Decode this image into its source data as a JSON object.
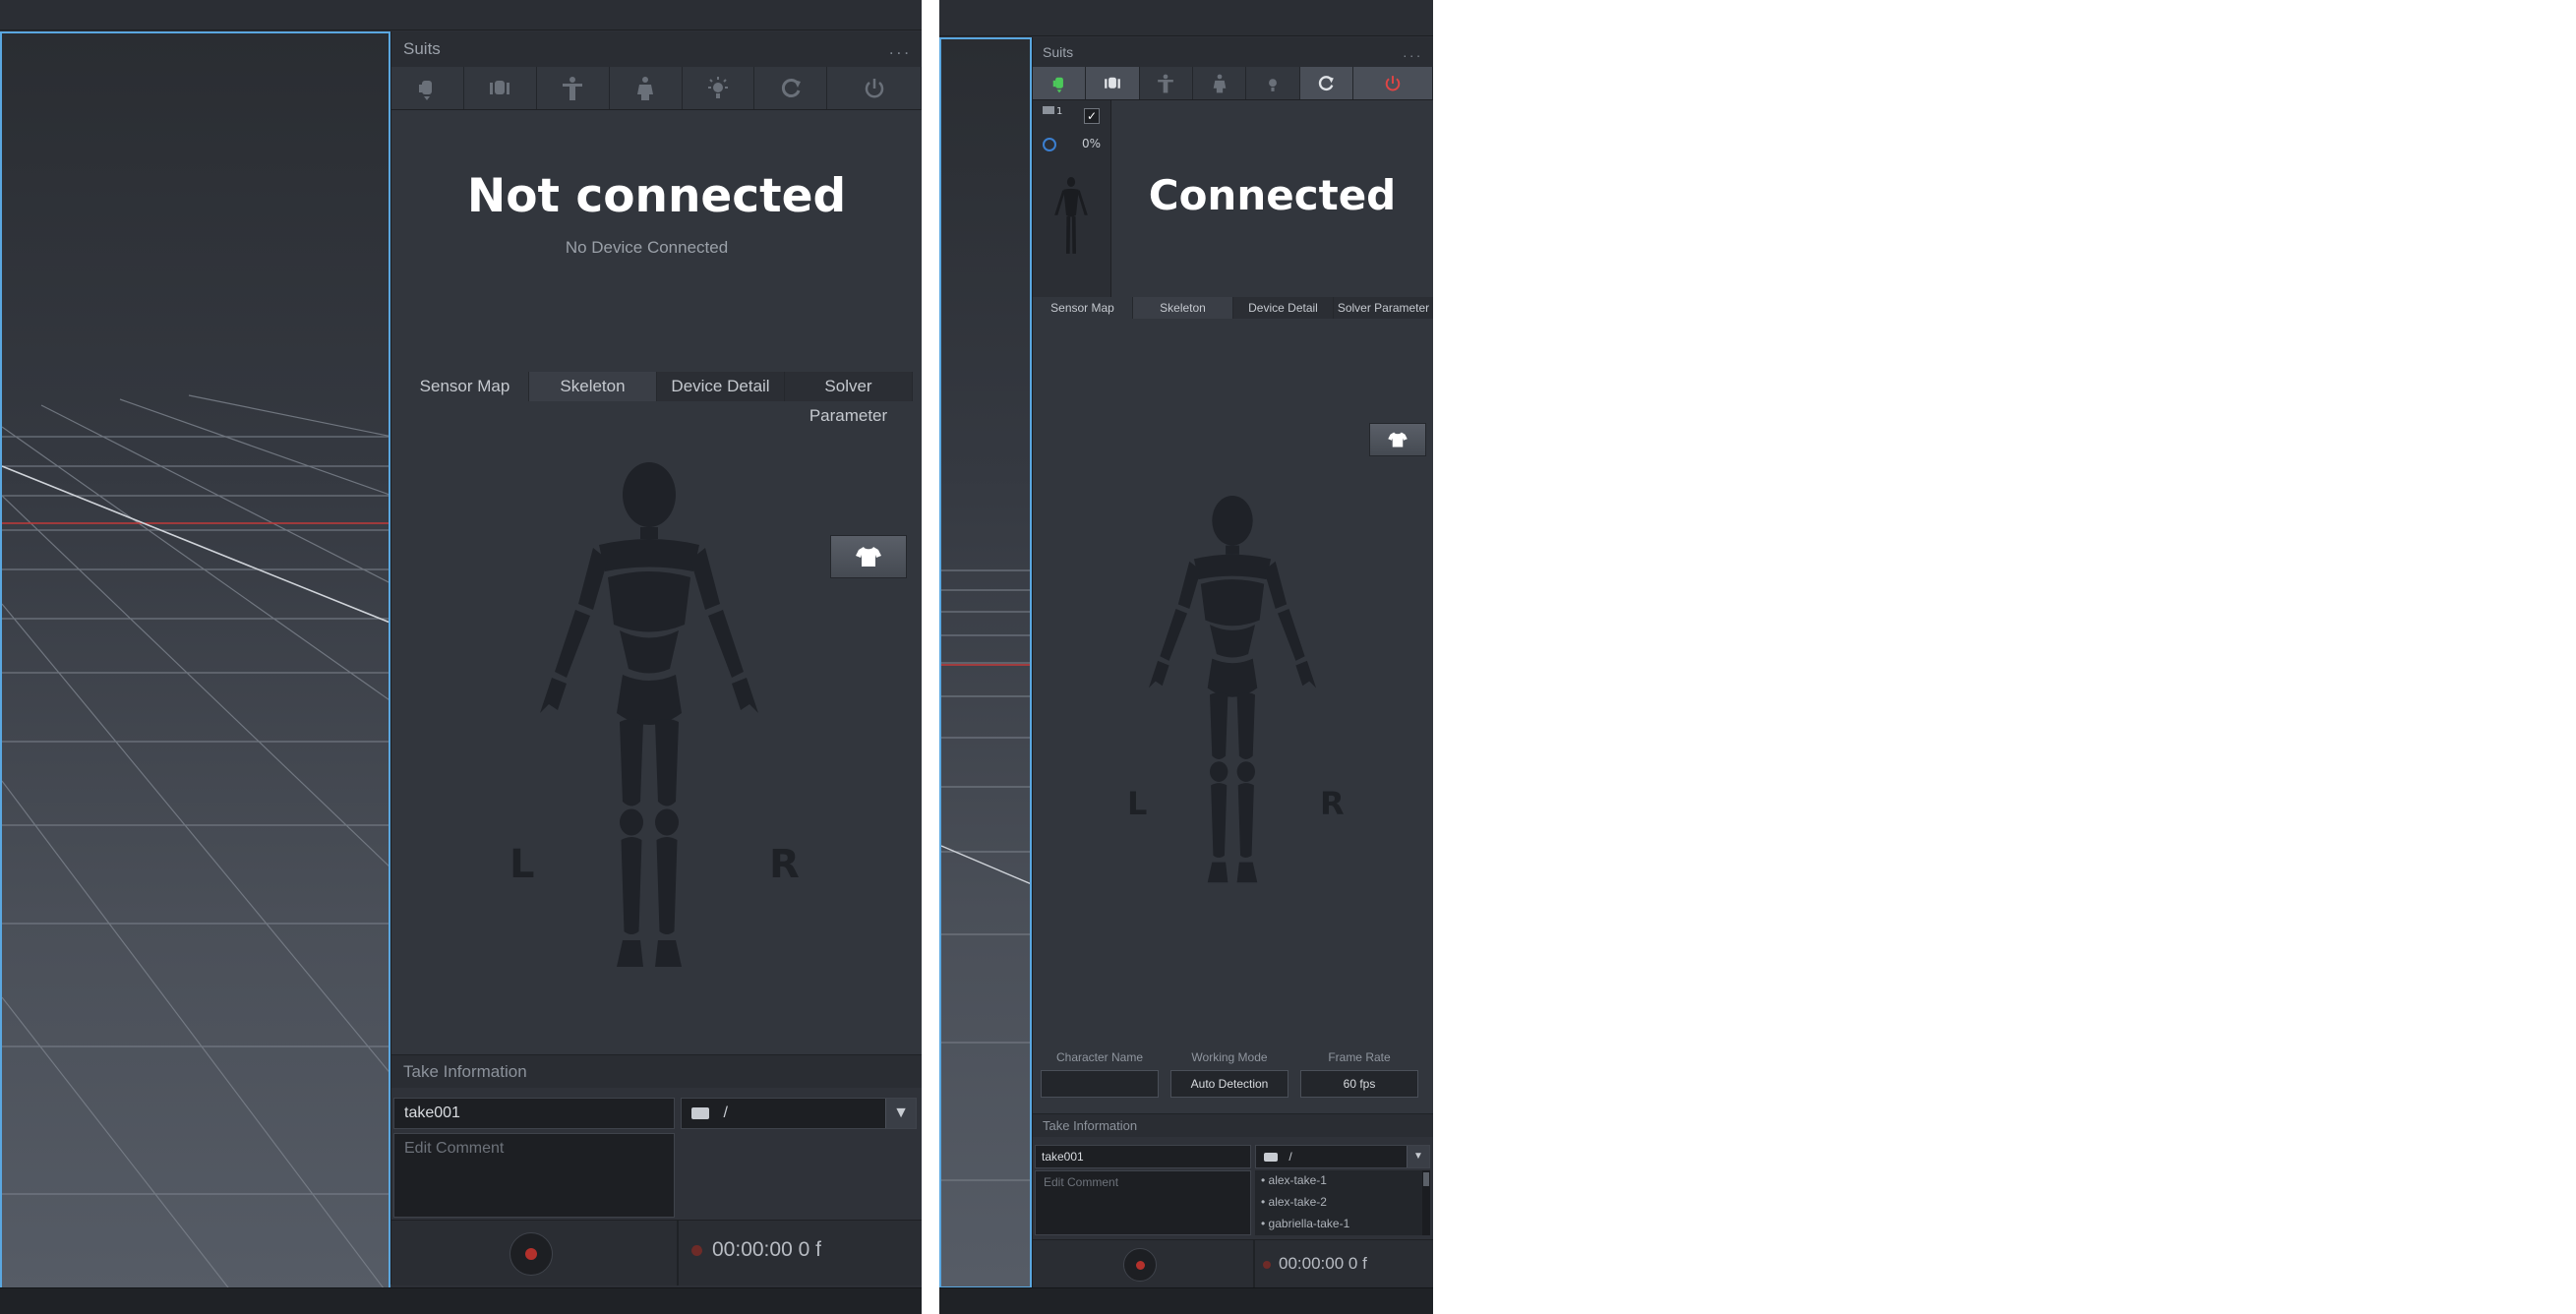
{
  "colors": {
    "accent_blue": "#5aa7e0",
    "record_red": "#b3312c",
    "power_red": "#e04545",
    "connected_green": "#4cc85a",
    "panel_bg": "#32363d"
  },
  "left": {
    "panel": {
      "title": "Suits",
      "menu_dots": "...",
      "toolbar_icons": [
        "suit-connect-icon",
        "suit-calibrate-icon",
        "tpose-icon",
        "body-icon",
        "light-icon",
        "reset-icon",
        "power-icon"
      ],
      "status_title": "Not connected",
      "status_subtitle": "No Device Connected",
      "tabs": [
        "Sensor Map",
        "Skeleton",
        "Device Detail",
        "Solver Parameter"
      ],
      "suit_button_icon": "shirt-icon",
      "label_left": "L",
      "label_right": "R"
    },
    "take": {
      "section_title": "Take Information",
      "name_value": "take001",
      "comment_placeholder": "Edit Comment",
      "folder_icon": "folder-open-icon",
      "folder_path": "/",
      "timecode": "00:00:00 0 f"
    }
  },
  "right": {
    "panel": {
      "title": "Suits",
      "menu_dots": "...",
      "toolbar_icons": [
        "suit-connect-icon",
        "suit-calibrate-icon",
        "tpose-icon",
        "body-icon",
        "light-icon",
        "reset-icon",
        "power-icon"
      ],
      "status_title": "Connected",
      "sensor_strip": {
        "device_number": "1",
        "checked": true,
        "battery_percent": "0%"
      },
      "tabs": [
        "Sensor Map",
        "Skeleton",
        "Device Detail",
        "Solver Parameter"
      ],
      "suit_button_icon": "shirt-icon",
      "label_left": "L",
      "label_right": "R"
    },
    "fields": {
      "character_name_label": "Character Name",
      "character_name_value": "",
      "working_mode_label": "Working Mode",
      "working_mode_value": "Auto Detection",
      "frame_rate_label": "Frame Rate",
      "frame_rate_value": "60 fps"
    },
    "take": {
      "section_title": "Take Information",
      "name_value": "take001",
      "comment_placeholder": "Edit Comment",
      "folder_icon": "folder-open-icon",
      "folder_path": "/",
      "take_list": [
        "alex-take-1",
        "alex-take-2",
        "gabriella-take-1"
      ],
      "timecode": "00:00:00 0 f"
    }
  }
}
